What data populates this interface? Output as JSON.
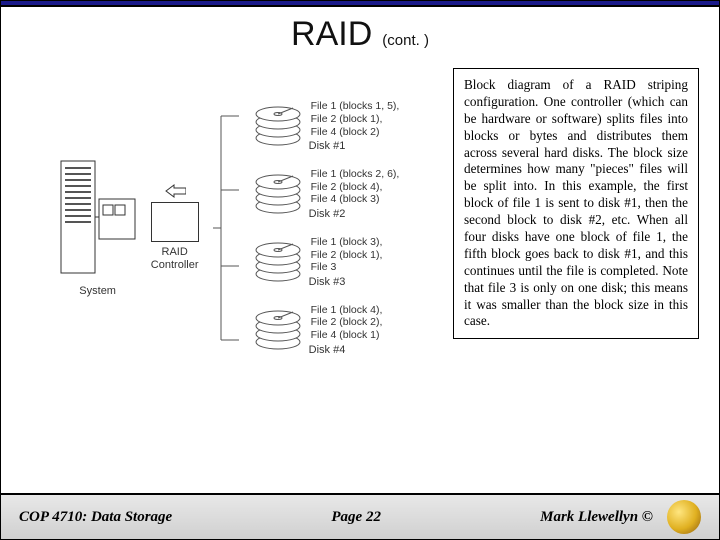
{
  "title": {
    "main": "RAID",
    "sub": "(cont. )"
  },
  "diagram": {
    "system_label": "System",
    "controller_label": "RAID\nController",
    "disks": [
      {
        "name": "Disk #1",
        "lines": "File 1 (blocks 1, 5),\nFile 2 (block 1),\nFile 4 (block 2)"
      },
      {
        "name": "Disk #2",
        "lines": "File 1 (blocks 2, 6),\nFile 2 (block 4),\nFile 4 (block 3)"
      },
      {
        "name": "Disk #3",
        "lines": "File 1 (block 3),\nFile 2 (block 1),\nFile 3"
      },
      {
        "name": "Disk #4",
        "lines": "File 1 (block 4),\nFile 2 (block 2),\nFile 4 (block 1)"
      }
    ]
  },
  "explanation": "Block diagram of a RAID striping configuration. One controller (which can be hardware or software) splits files into blocks or bytes and distributes them across several hard disks. The block size determines how many \"pieces\" files will be split into. In this example, the first block of file 1 is sent to disk #1, then the second block to disk #2, etc. When all four disks have one block of file 1, the fifth block goes back to disk #1, and this continues until the file is completed. Note that file 3 is only on one disk; this means it was smaller than the block size in this case.",
  "footer": {
    "left": "COP 4710: Data Storage",
    "center": "Page 22",
    "right": "Mark Llewellyn ©"
  },
  "icons": {
    "logo": "ucf-pegasus-logo"
  }
}
